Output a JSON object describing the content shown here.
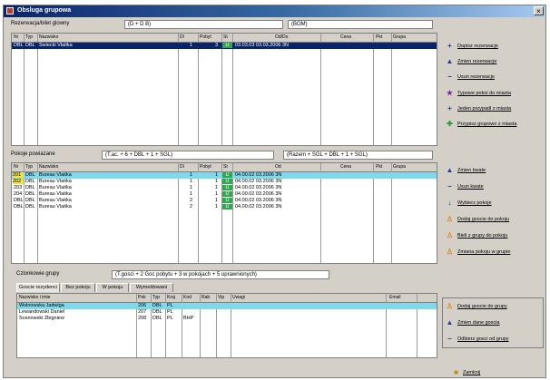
{
  "window": {
    "title": "Obsluga grupowa",
    "close": "×"
  },
  "main_section": {
    "label": "Rezerwacja/bilet glowny",
    "field1": "(D + D B)",
    "field2": "(BOM)"
  },
  "main_grid": {
    "headers": [
      "Nr",
      "Typ",
      "Nazwisko",
      "Dl",
      "Pobyt",
      "St",
      "Od/Do",
      "Cena",
      "Pkt",
      "Grupa"
    ],
    "rows": [
      {
        "nr": "DBL",
        "typ": "DBL",
        "name": "Swiecki Vlaitka",
        "dl": "1",
        "pob": "3",
        "st": "U",
        "od": "03.03.03 03.03.2006 3N"
      }
    ]
  },
  "rooms_section": {
    "label": "Pokoje powiazane",
    "field1": "(T.ac. + 6 + DBL + 1 + SGL)",
    "field2": "(Razem + SGL + DBL + 1 + SGL)"
  },
  "rooms_grid": {
    "headers": [
      "Nr",
      "Typ",
      "Nazwisko",
      "Dl",
      "Pobyt",
      "St",
      "Od",
      "Cena",
      "Pkt",
      "Grupa"
    ],
    "rows": [
      {
        "nr": "201",
        "typ": "DBL",
        "name": "Bureau Vlaitka",
        "dl": "1",
        "pob": "1",
        "st": "U",
        "od": "04.00.02 03.2006 3N"
      },
      {
        "nr": "202",
        "typ": "DBL",
        "name": "Bureau Vlaitka",
        "dl": "1",
        "pob": "1",
        "st": "U",
        "od": "04.00.02 03.2006 3N"
      },
      {
        "nr": "203",
        "typ": "DBL",
        "name": "Bureau Vlaitka",
        "dl": "1",
        "pob": "1",
        "st": "U",
        "od": "04.00.02 03.2006 3N"
      },
      {
        "nr": "204",
        "typ": "DBL",
        "name": "Bureau Vlaitka",
        "dl": "1",
        "pob": "1",
        "st": "U",
        "od": "04.00.02 03.2006 3N"
      },
      {
        "nr": "DBL",
        "typ": "DBL",
        "name": "Bureau Vlaitka",
        "dl": "2",
        "pob": "1",
        "st": "U",
        "od": "04.00.02 03.2006 3N"
      },
      {
        "nr": "DBL",
        "typ": "DBL",
        "name": "Bureau Vlaitka",
        "dl": "2",
        "pob": "1",
        "st": "U",
        "od": "04.00.02 03.2006 3N"
      }
    ]
  },
  "group_section": {
    "label": "Czlonkowie grupy",
    "field": "(T.gosci + 2 Goc pobytu + 3 w pokojach + 5 uprawnionych)"
  },
  "tabs": [
    "Goscie rezydenci",
    "Bez pokoju",
    "W pokoju",
    "Wymeldowani"
  ],
  "guests_grid": {
    "headers": [
      "Nazwisko i imie",
      "Pok",
      "Typ",
      "Kraj",
      "Kod",
      "Rab",
      "Vip",
      "Uwagi",
      "Email"
    ],
    "rows": [
      {
        "name": "Wolnowska Jadwiga",
        "pok": "206",
        "typ": "DBL",
        "kraj": "PL",
        "kod": ""
      },
      {
        "name": "Lewandowski Daniel",
        "pok": "207",
        "typ": "DBL",
        "kraj": "PL",
        "kod": ""
      },
      {
        "name": "Sosnowski Zbigniew",
        "pok": "208",
        "typ": "DBL",
        "kraj": "PL",
        "kod": "BHP"
      }
    ]
  },
  "buttons_top": [
    {
      "icon": "+",
      "label": "Dopisz rezerwacje"
    },
    {
      "icon": "▲",
      "label": "Zmien rezerwacje"
    },
    {
      "icon": "−",
      "label": "Usun rezerwacje"
    },
    {
      "icon": "★",
      "label": "Typowe pokoi do miasta"
    },
    {
      "icon": "+",
      "label": "Jeden przypadl z miasta"
    },
    {
      "icon": "✚",
      "label": "Przypisz grupowo z miasta"
    }
  ],
  "buttons_mid": [
    {
      "icon": "▲",
      "label": "Zmien kwate"
    },
    {
      "icon": "−",
      "label": "Usun kwate"
    },
    {
      "icon": "↓",
      "label": "Wybierz pokoje"
    },
    {
      "icon": "♙",
      "label": "Dodaj goscie do pokoju"
    },
    {
      "icon": "♙",
      "label": "Bieli z grupy do pokoju"
    },
    {
      "icon": "♙",
      "label": "Zmiana pokoju w grupie"
    }
  ],
  "buttons_bottom": [
    {
      "icon": "♙",
      "label": "Dodaj goscie do grupy"
    },
    {
      "icon": "▲",
      "label": "Zmien dane goscia"
    },
    {
      "icon": "−",
      "label": "Odbierz gosci od grupy"
    }
  ],
  "close_button": {
    "icon": "■",
    "label": "Zamknij"
  },
  "colors": {
    "title_bar": "#0a246a",
    "selected_row": "#0a246a",
    "highlight_row": "#7fd9ea",
    "status_cell": "#2fa84f",
    "blue_icon": "#1a3fa0",
    "orange_icon": "#d98a1a"
  }
}
